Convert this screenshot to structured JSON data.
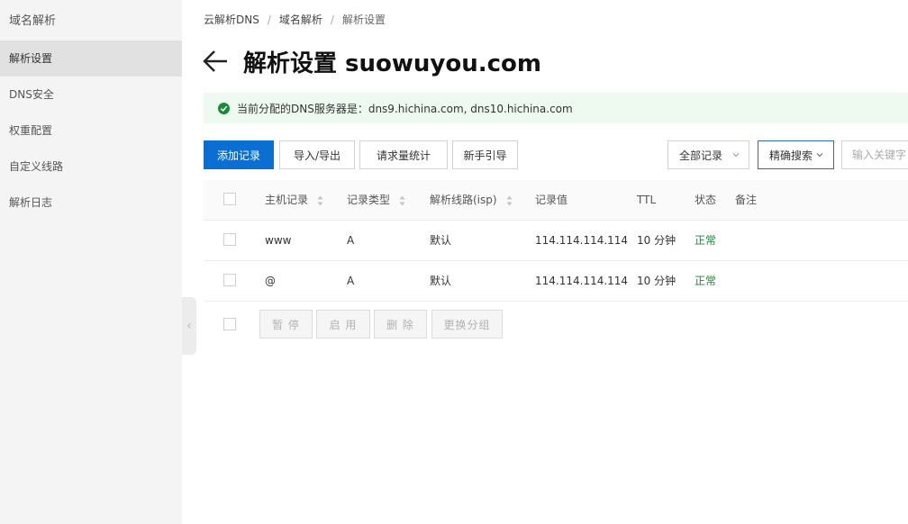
{
  "sidebar": {
    "title": "域名解析",
    "items": [
      {
        "label": "解析设置",
        "active": true
      },
      {
        "label": "DNS安全"
      },
      {
        "label": "权重配置"
      },
      {
        "label": "自定义线路"
      },
      {
        "label": "解析日志"
      }
    ]
  },
  "breadcrumb": [
    "云解析DNS",
    "域名解析",
    "解析设置"
  ],
  "page_title": "解析设置 suowuyou.com",
  "notice": {
    "text": "当前分配的DNS服务器是：dns9.hichina.com, dns10.hichina.com"
  },
  "toolbar": {
    "add": "添加记录",
    "import_export": "导入/导出",
    "stats": "请求量统计",
    "guide": "新手引导",
    "filter_select": "全部记录",
    "precise_search": "精确搜索",
    "search_placeholder": "输入关键字"
  },
  "table": {
    "headers": [
      "主机记录",
      "记录类型",
      "解析线路(isp)",
      "记录值",
      "TTL",
      "状态",
      "备注"
    ],
    "rows": [
      {
        "host": "www",
        "type": "A",
        "line": "默认",
        "value": "114.114.114.114",
        "ttl": "10 分钟",
        "status": "正常",
        "remark": ""
      },
      {
        "host": "@",
        "type": "A",
        "line": "默认",
        "value": "114.114.114.114",
        "ttl": "10 分钟",
        "status": "正常",
        "remark": ""
      }
    ]
  },
  "bulk_actions": [
    "暂 停",
    "启 用",
    "删 除",
    "更换分组"
  ],
  "colors": {
    "primary": "#0a6fd0",
    "success": "#1a8a3a",
    "notice_bg": "#eefaf0"
  },
  "icons": {
    "back": "arrow-left-icon",
    "notice": "check-circle-icon",
    "collapse": "chevron-left-icon"
  }
}
